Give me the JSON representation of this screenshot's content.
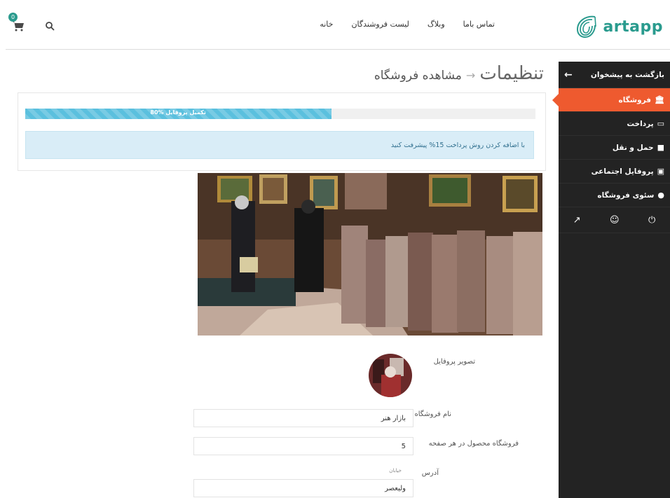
{
  "header": {
    "logo_text": "artapp",
    "nav": [
      "خانه",
      "لیست فروشندگان",
      "وبلاگ",
      "تماس باما"
    ],
    "cart_count": "0",
    "brand_color": "#2a9b8e"
  },
  "sidebar": {
    "back_label": "بازگشت به پیشخوان",
    "items": [
      {
        "label": "فروشگاه",
        "icon": "bank-icon",
        "active": true
      },
      {
        "label": "پرداخت",
        "icon": "credit-card-icon",
        "active": false
      },
      {
        "label": "حمل و نقل",
        "icon": "truck-icon",
        "active": false
      },
      {
        "label": "پروفایل اجتماعی",
        "icon": "share-icon",
        "active": false
      },
      {
        "label": "سئوی فروشگاه",
        "icon": "globe-icon",
        "active": false
      }
    ],
    "bottom_icons": [
      "external-link-icon",
      "user-icon",
      "power-icon"
    ],
    "active_color": "#ee5a2f"
  },
  "page": {
    "title": "تنظیمات",
    "separator": "→",
    "subtitle": "مشاهده فروشگاه"
  },
  "progress": {
    "label": "80% تکمیل پروفایل",
    "value": 0.6
  },
  "alert": {
    "text": "با اضافه کردن روش پرداخت 15% پیشرفت کنید"
  },
  "form": {
    "profile_photo_label": "تصویر پروفایل",
    "store_name_label": "نام فروشگاه",
    "store_name_value": "بازار هنر",
    "products_per_page_label": "فروشگاه محصول در هر صفحه",
    "products_per_page_value": "5",
    "address_label": "آدرس",
    "address_hint": "خیابان",
    "address_value": "ولیعصر"
  }
}
